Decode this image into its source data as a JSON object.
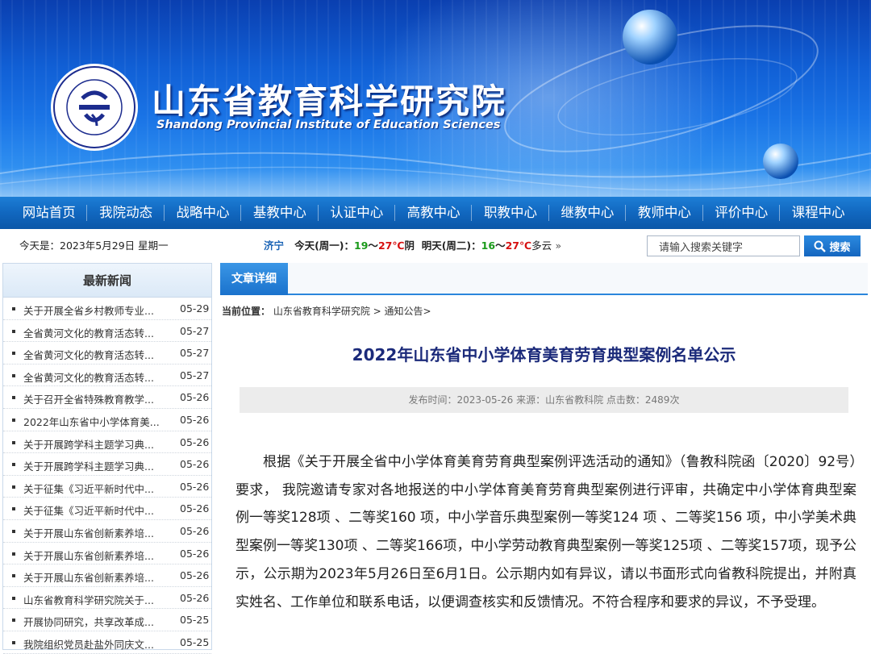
{
  "header": {
    "title": "山东省教育科学研究院",
    "subtitle": "Shandong Provincial Institute of Education Sciences",
    "logo_text": "山东省教育科学研究院 Shandong Provincial Institute of Education Sciences"
  },
  "nav": {
    "items": [
      "网站首页",
      "我院动态",
      "战略中心",
      "基教中心",
      "认证中心",
      "高教中心",
      "职教中心",
      "继教中心",
      "教师中心",
      "评价中心",
      "课程中心"
    ]
  },
  "infobar": {
    "date": "今天是：2023年5月29日 星期一",
    "weather": {
      "city": "济宁",
      "today_label": "今天(周一)：",
      "today_low": "19",
      "today_high": "27℃",
      "today_cond": "阴",
      "tomorrow_label": "明天(周二)：",
      "tomorrow_low": "16",
      "tomorrow_high": "27℃",
      "tomorrow_cond": "多云",
      "sep": "～",
      "more": "»"
    },
    "search_placeholder": "请输入搜索关键字",
    "search_button": "搜索"
  },
  "sidebar": {
    "heading": "最新新闻",
    "items": [
      {
        "title": "关于开展全省乡村教师专业...",
        "date": "05-29"
      },
      {
        "title": "全省黄河文化的教育活态转...",
        "date": "05-27"
      },
      {
        "title": "全省黄河文化的教育活态转...",
        "date": "05-27"
      },
      {
        "title": "全省黄河文化的教育活态转...",
        "date": "05-27"
      },
      {
        "title": "关于召开全省特殊教育教学...",
        "date": "05-26"
      },
      {
        "title": "2022年山东省中小学体育美...",
        "date": "05-26"
      },
      {
        "title": "关于开展跨学科主题学习典...",
        "date": "05-26"
      },
      {
        "title": "关于开展跨学科主题学习典...",
        "date": "05-26"
      },
      {
        "title": "关于征集《习近平新时代中...",
        "date": "05-26"
      },
      {
        "title": "关于征集《习近平新时代中...",
        "date": "05-26"
      },
      {
        "title": "关于开展山东省创新素养培...",
        "date": "05-26"
      },
      {
        "title": "关于开展山东省创新素养培...",
        "date": "05-26"
      },
      {
        "title": "关于开展山东省创新素养培...",
        "date": "05-26"
      },
      {
        "title": "山东省教育科学研究院关于...",
        "date": "05-26"
      },
      {
        "title": "开展协同研究，共享改革成...",
        "date": "05-25"
      },
      {
        "title": "我院组织党员赴盐外同庆文...",
        "date": "05-25"
      }
    ]
  },
  "main": {
    "tab_label": "文章详细",
    "breadcrumb_prefix": "当前位置：",
    "breadcrumb_path": "山东省教育科学研究院 > 通知公告>",
    "article_title": "2022年山东省中小学体育美育劳育典型案例名单公示",
    "meta": "发布时间：2023-05-26 来源：山东省教科院 点击数：2489次",
    "body": "根据《关于开展全省中小学体育美育劳育典型案例评选活动的通知》（鲁教科院函〔2020〕92号）要求， 我院邀请专家对各地报送的中小学体育美育劳育典型案例进行评审，共确定中小学体育典型案例一等奖128项 、二等奖160 项，中小学音乐典型案例一等奖124 项 、二等奖156 项，中小学美术典型案例一等奖130项 、二等奖166项，中小学劳动教育典型案例一等奖125项 、二等奖157项，现予公示，公示期为2023年5月26日至6月1日。公示期内如有异议，请以书面形式向省教科院提出，并附真实姓名、工作单位和联系电话，以便调查核实和反馈情况。不符合程序和要求的异议，不予受理。"
  },
  "colors": {
    "banner_blue": "#1160d6",
    "nav_blue": "#1167bf",
    "title_navy": "#1b2a7a",
    "temp_low_green": "#1a9a1a",
    "temp_high_red": "#d61010"
  }
}
